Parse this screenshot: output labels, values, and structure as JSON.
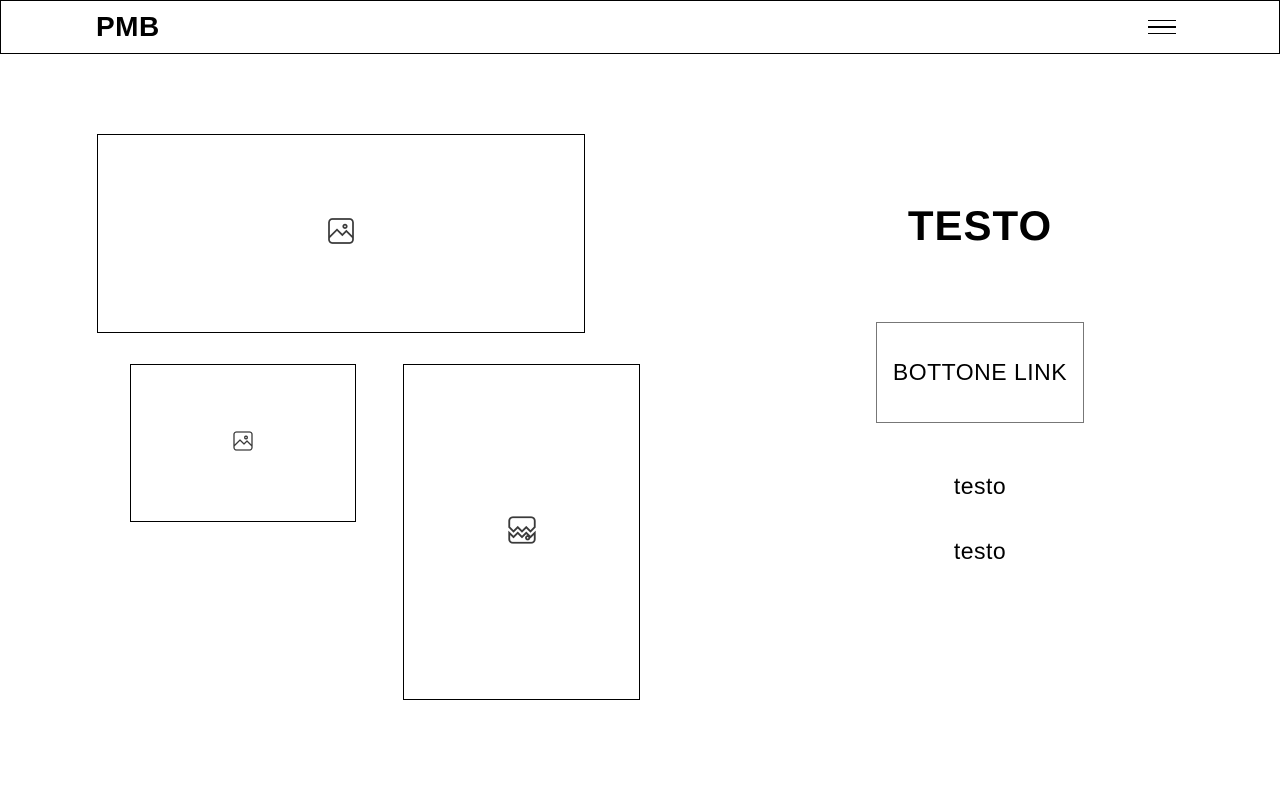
{
  "header": {
    "logo": "PMB"
  },
  "main": {
    "heading": "TESTO",
    "button_label": "BOTTONE LINK",
    "text_items": [
      "testo",
      "testo"
    ]
  }
}
